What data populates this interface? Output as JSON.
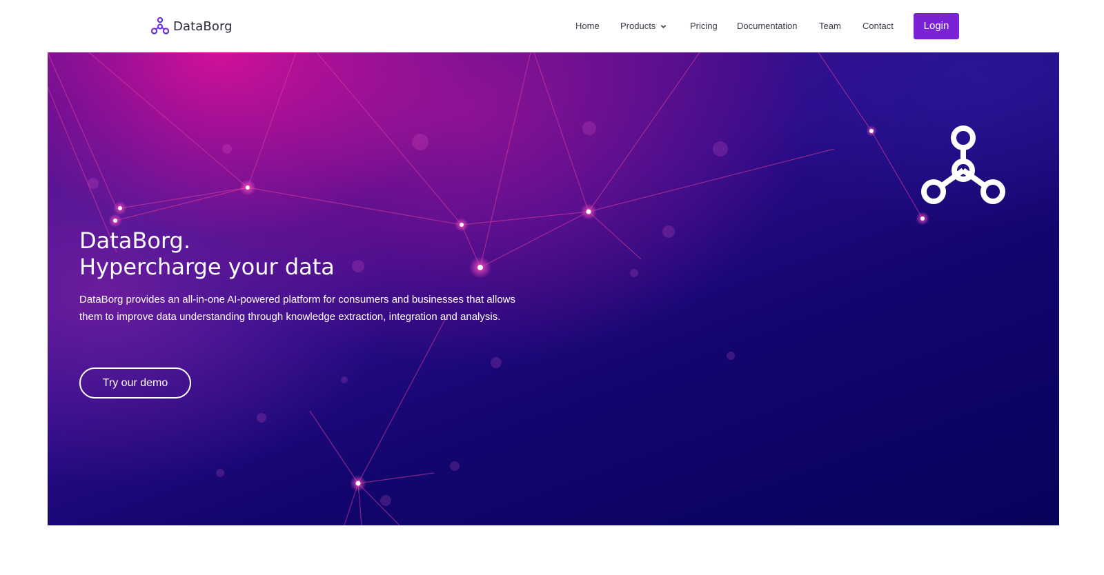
{
  "header": {
    "brand_name": "DataBorg",
    "nav": [
      {
        "label": "Home"
      },
      {
        "label": "Products"
      },
      {
        "label": "Pricing"
      },
      {
        "label": "Documentation"
      },
      {
        "label": "Team"
      },
      {
        "label": "Contact"
      }
    ],
    "login_label": "Login"
  },
  "hero": {
    "title_line1": "DataBorg.",
    "title_line2": "Hypercharge your data",
    "description": "DataBorg provides an all-in-one AI-powered platform for consumers and businesses that allows them to improve data understanding through knowledge extraction, integration and analysis.",
    "cta_label": "Try our demo"
  },
  "icons": {
    "brand_logo": "network-nodes-icon",
    "products_dropdown": "chevron-down-icon",
    "hero_logo": "network-nodes-icon"
  },
  "colors": {
    "accent": "#7c22d6",
    "hero_pink": "#d6109a",
    "hero_navy": "#07035a",
    "nav_text": "#3b3b48"
  }
}
